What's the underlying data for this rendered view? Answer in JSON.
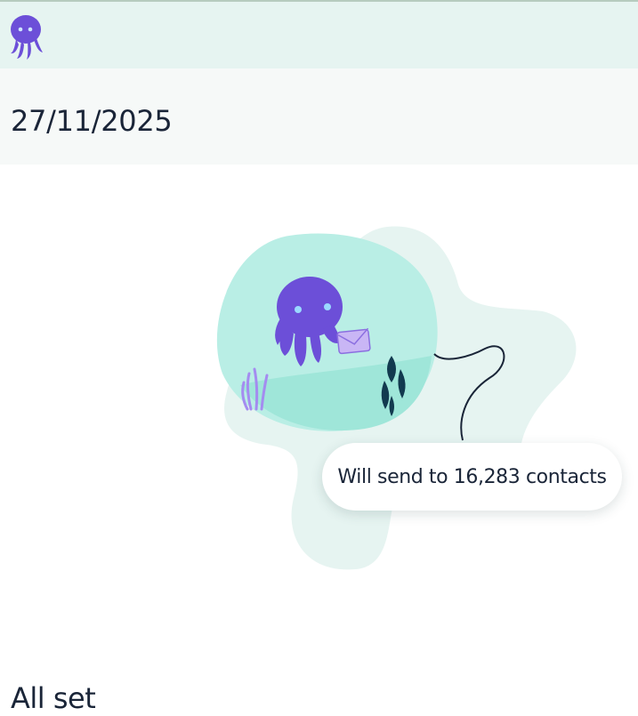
{
  "header": {
    "logo_icon": "octopus-logo-icon",
    "brand_color": "#6c4fd8",
    "background": "#e6f4f1"
  },
  "schedule": {
    "date": "27/11/2025"
  },
  "illustration": {
    "icon": "octopus-sending-envelope-illustration",
    "blob_color": "#b9eee5",
    "shadow_blob_color": "#e6f4f1"
  },
  "send_summary": {
    "text": "Will send to 16,283 contacts"
  },
  "status": {
    "heading": "All set"
  }
}
